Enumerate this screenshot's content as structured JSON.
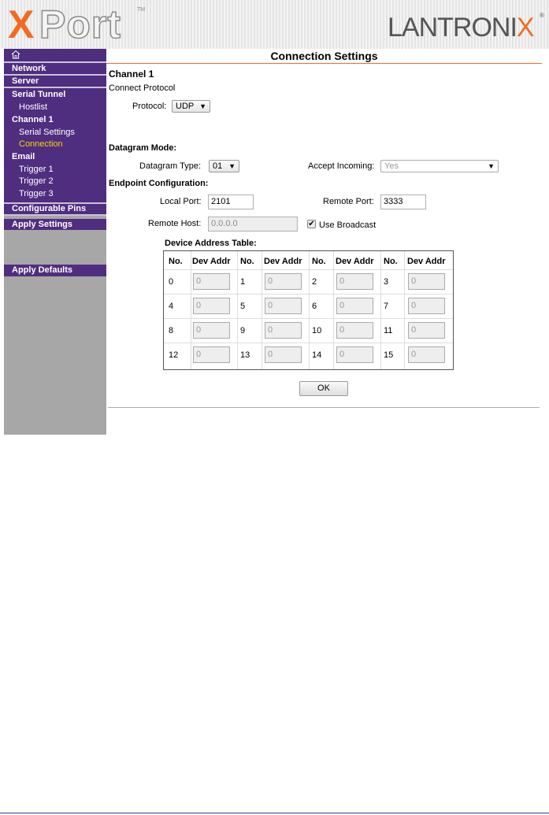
{
  "header": {
    "logo_x": "X",
    "logo_port": "Port",
    "logo_tm": "TM",
    "brand_pre": "LANTRONI",
    "brand_x": "X",
    "brand_reg": "®"
  },
  "sidebar": {
    "network": "Network",
    "server": "Server",
    "serial_tunnel": "Serial Tunnel",
    "hostlist": "Hostlist",
    "channel1": "Channel 1",
    "serial_settings": "Serial Settings",
    "connection": "Connection",
    "email": "Email",
    "trigger1": "Trigger 1",
    "trigger2": "Trigger 2",
    "trigger3": "Trigger 3",
    "configurable_pins": "Configurable Pins",
    "apply_settings": "Apply Settings",
    "apply_defaults": "Apply Defaults"
  },
  "main": {
    "title": "Connection Settings",
    "channel_heading": "Channel 1",
    "connect_protocol": "Connect Protocol",
    "protocol_label": "Protocol:",
    "protocol_value": "UDP",
    "datagram_mode": "Datagram Mode:",
    "datagram_type_label": "Datagram Type:",
    "datagram_type_value": "01",
    "accept_incoming_label": "Accept Incoming:",
    "accept_incoming_value": "Yes",
    "endpoint_config": "Endpoint Configuration:",
    "local_port_label": "Local Port:",
    "local_port_value": "2101",
    "remote_port_label": "Remote Port:",
    "remote_port_value": "3333",
    "remote_host_label": "Remote Host:",
    "remote_host_value": "0.0.0.0",
    "use_broadcast_label": "Use Broadcast",
    "use_broadcast_checked": "✔",
    "device_table_title": "Device Address Table:",
    "col_no": "No.",
    "col_dev": "Dev Addr",
    "rows": [
      [
        "0",
        "0",
        "1",
        "0",
        "2",
        "0",
        "3",
        "0"
      ],
      [
        "4",
        "0",
        "5",
        "0",
        "6",
        "0",
        "7",
        "0"
      ],
      [
        "8",
        "0",
        "9",
        "0",
        "10",
        "0",
        "11",
        "0"
      ],
      [
        "12",
        "0",
        "13",
        "0",
        "14",
        "0",
        "15",
        "0"
      ]
    ],
    "ok_label": "OK"
  }
}
